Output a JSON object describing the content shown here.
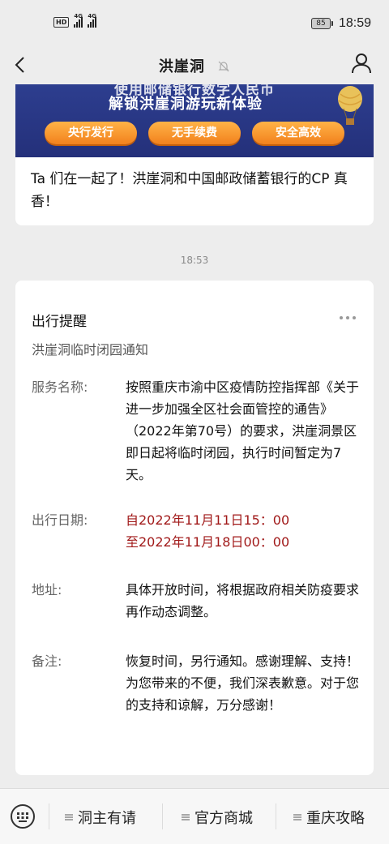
{
  "status_bar": {
    "network_badge": "HD",
    "sig1_label": "4G",
    "sig2_label": "4G",
    "battery": "85",
    "time": "18:59"
  },
  "nav": {
    "title": "洪崖洞"
  },
  "article": {
    "banner_top": "使用邮储银行数字人民币",
    "banner_sub": "解锁洪崖洞游玩新体验",
    "pills": [
      "央行发行",
      "无手续费",
      "安全高效"
    ],
    "title": "Ta 们在一起了！洪崖洞和中国邮政储蓄银行的CP 真香！"
  },
  "timestamp": "18:53",
  "notice": {
    "title": "出行提醒",
    "subtitle": "洪崖洞临时闭园通知",
    "rows": [
      {
        "label": "服务名称:",
        "value": " 按照重庆市渝中区疫情防控指挥部《关于进一步加强全区社会面管控的通告》（2022年第70号）的要求，洪崖洞景区即日起将临时闭园，执行时间暂定为7天。"
      },
      {
        "label": "出行日期:",
        "value_line1": "自2022年11月11日15：00",
        "value_line2": "至2022年11月18日00：00"
      },
      {
        "label": "地址:",
        "value": "具体开放时间，将根据政府相关防疫要求再作动态调整。"
      },
      {
        "label": "备注:",
        "value": "恢复时间，另行通知。感谢理解、支持！为您带来的不便，我们深表歉意。对于您的支持和谅解，万分感谢！"
      }
    ]
  },
  "menu": {
    "items": [
      "洞主有请",
      "官方商城",
      "重庆攻略"
    ]
  },
  "colors": {
    "accent_red": "#a11a1a",
    "banner_blue": "#24307a",
    "pill_orange": "#f2811d"
  },
  "icons": [
    "keyboard-icon",
    "back-arrow-icon",
    "bell-muted-icon",
    "profile-icon",
    "more-icon",
    "menu-list-icon",
    "hot-air-balloon-icon"
  ]
}
